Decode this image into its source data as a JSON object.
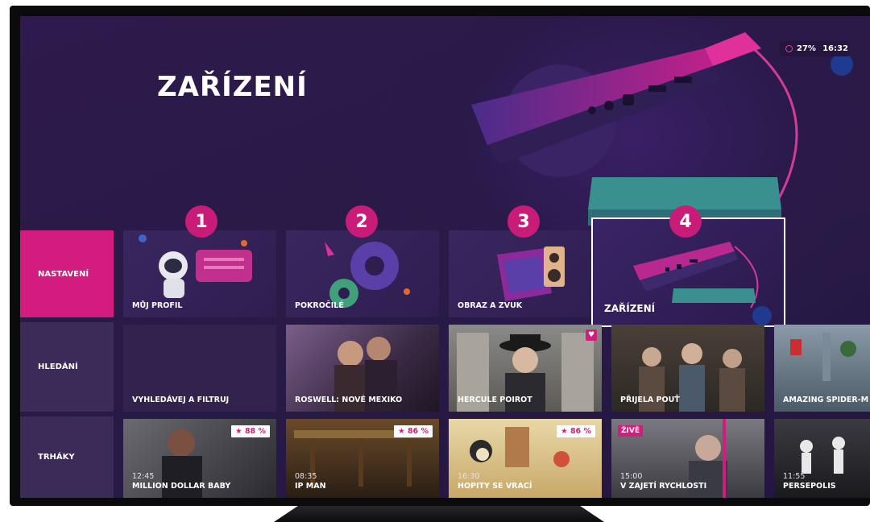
{
  "page_title": "ZAŘÍZENÍ",
  "status": {
    "battery": "27%",
    "time": "16:32"
  },
  "sidebar": {
    "items": [
      {
        "label": "NASTAVENÍ",
        "active": true
      },
      {
        "label": "HLEDÁNÍ",
        "active": false
      },
      {
        "label": "TRHÁKY",
        "active": false
      }
    ]
  },
  "settings": {
    "tiles": [
      {
        "label": "MŮJ PROFIL"
      },
      {
        "label": "POKROČILÉ"
      },
      {
        "label": "OBRAZ A ZVUK"
      },
      {
        "label": "ZAŘÍZENÍ",
        "focused": true
      }
    ]
  },
  "callouts": [
    "1",
    "2",
    "3",
    "4"
  ],
  "search": {
    "tiles": [
      {
        "label": "VYHLEDÁVEJ A FILTRUJ"
      },
      {
        "label": "ROSWELL: NOVÉ MEXIKO"
      },
      {
        "label": "HERCULE POIROT"
      },
      {
        "label": "PŘIJELA POUŤ"
      },
      {
        "label": "AMAZING SPIDER-M"
      }
    ]
  },
  "hits": {
    "tiles": [
      {
        "time": "12:45",
        "title": "MILLION DOLLAR BABY",
        "rating": "★ 88 %"
      },
      {
        "time": "08:35",
        "title": "IP MAN",
        "rating": "★ 86 %"
      },
      {
        "time": "16:30",
        "title": "HOPITY SE VRACÍ",
        "rating": "★ 86 %"
      },
      {
        "time": "15:00",
        "title": "V ZAJETÍ RYCHLOSTI",
        "badge": "ŽIVĚ"
      },
      {
        "time": "11:55",
        "title": "PERSEPOLIS"
      }
    ]
  },
  "colors": {
    "accent": "#d41c80",
    "background": "#2a1a46",
    "tile": "#35244f",
    "sidebar": "#3b2b58"
  },
  "icons": [
    "battery-ring-icon",
    "heart-icon",
    "star-icon"
  ]
}
